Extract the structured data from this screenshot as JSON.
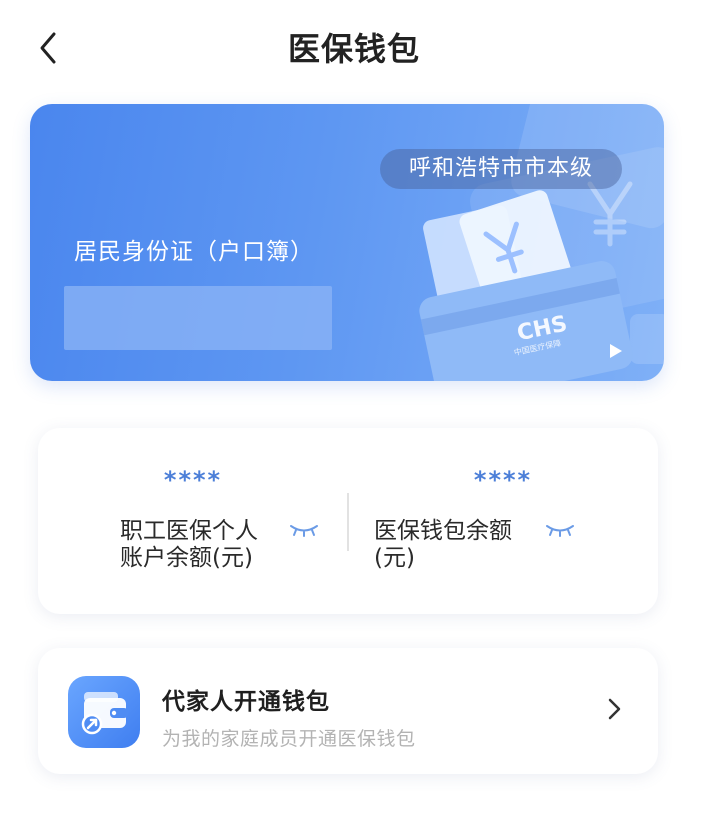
{
  "header": {
    "title": "医保钱包",
    "back_icon": "chevron-left-icon"
  },
  "card": {
    "region": "呼和浩特市市本级",
    "id_type": "居民身份证（户口簿）",
    "logo_text": "CHS",
    "logo_subtext": "中国医疗保障",
    "play_icon": "play-icon"
  },
  "balances": [
    {
      "value": "****",
      "label_line1": "职工医保个人",
      "label_line2": "账户余额(元)",
      "eye_icon": "eye-closed-icon"
    },
    {
      "value": "****",
      "label_line1": "医保钱包余额",
      "label_line2": "(元)",
      "eye_icon": "eye-closed-icon"
    }
  ],
  "family": {
    "title": "代家人开通钱包",
    "subtitle": "为我的家庭成员开通医保钱包",
    "icon": "wallet-icon",
    "arrow_icon": "chevron-right-icon"
  },
  "colors": {
    "accent": "#4c7fd8",
    "card_start": "#4a86ee",
    "card_end": "#7fb0f7"
  }
}
